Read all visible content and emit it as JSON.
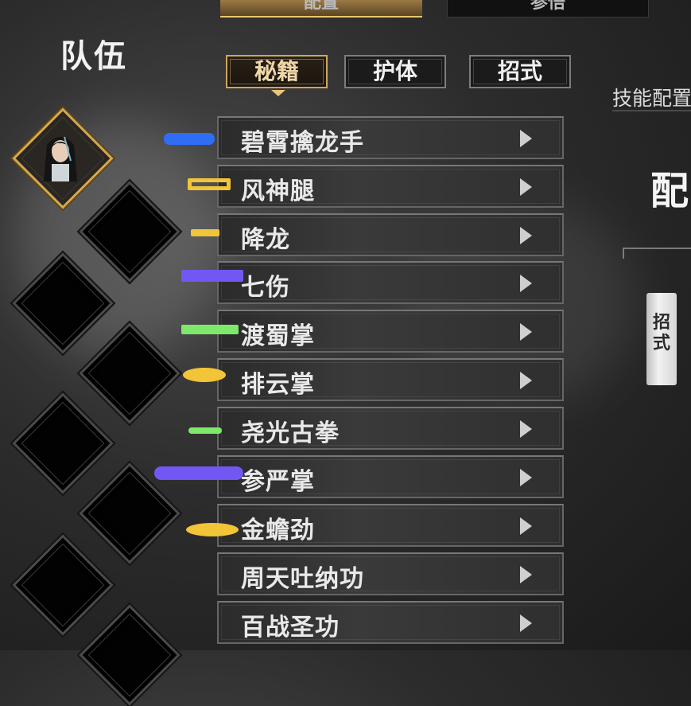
{
  "top_tabs": [
    {
      "label": "配置",
      "active": true
    },
    {
      "label": "参悟",
      "active": false
    }
  ],
  "team": {
    "title": "队伍"
  },
  "sub_tabs": [
    {
      "label": "秘籍",
      "active": true
    },
    {
      "label": "护体",
      "active": false
    },
    {
      "label": "招式",
      "active": false
    }
  ],
  "skills": [
    {
      "label": "碧霄擒龙手",
      "mark_color": "#2f6ef2"
    },
    {
      "label": "风神腿",
      "mark_color": "#f2c437"
    },
    {
      "label": "降龙",
      "mark_color": "#f2c437"
    },
    {
      "label": "七伤",
      "mark_color": "#7357f2"
    },
    {
      "label": "渡蜀掌",
      "mark_color": "#7de86a"
    },
    {
      "label": "排云掌",
      "mark_color": "#f2c437"
    },
    {
      "label": "尧光古拳",
      "mark_color": "#7de86a"
    },
    {
      "label": "参严掌",
      "mark_color": "#7357f2"
    },
    {
      "label": "金蟾劲",
      "mark_color": "#f2c437"
    },
    {
      "label": "周天吐纳功",
      "mark_color": null
    },
    {
      "label": "百战圣功",
      "mark_color": null
    }
  ],
  "right_panel": {
    "config_label": "技能配置",
    "heading": "配",
    "vertical_button": "招式"
  },
  "colors": {
    "accent_gold": "#d4a84f",
    "background": "#2c2c2c"
  }
}
